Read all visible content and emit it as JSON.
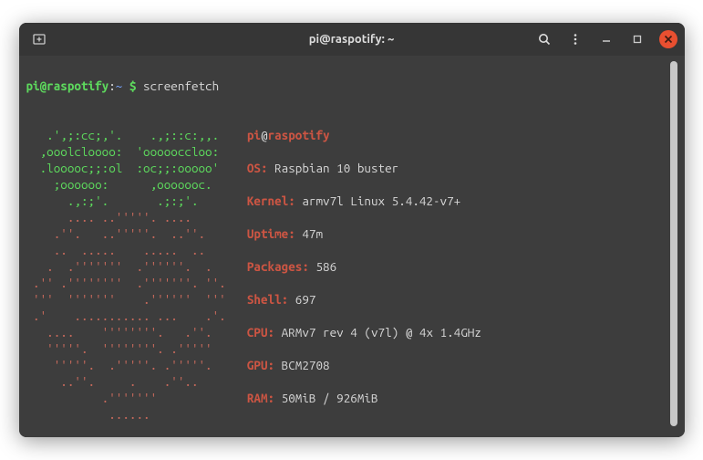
{
  "titlebar": {
    "title": "pi@raspotify: ~"
  },
  "prompt": {
    "user": "pi@raspotify",
    "sep": ":",
    "path": "~",
    "dollar": "$"
  },
  "command": "screenfetch",
  "ascii": {
    "l01": "   .',;:cc;,'.    .,;::c:,,.   ",
    "l02": "  ,ooolcloooo:  'oooooccloo:   ",
    "l03": "  .looooc;;:ol  :oc;;:ooooo'   ",
    "l04": "    ;oooooo:      ,ooooooc.    ",
    "l05": "      .,:;'.       .;:;'.      ",
    "l06": "      .... ..'''''. ....       ",
    "l07": "    .''.   ..'''''.  ..''.     ",
    "l08": "    ..  .....    .....  ..     ",
    "l09": "   .  .'''''''  .''''''.  .    ",
    "l10": " .'' .''''''''  .'''''''. ''.  ",
    "l11": " '''  '''''''    .''''''  '''  ",
    "l12": " .'    ........... ...    .'.  ",
    "l13": "   ....    ''''''''.   .''.    ",
    "l14": "   '''''.  ''''''''. .'''''    ",
    "l15": "    '''''.  .'''''. .'''''.    ",
    "l16": "     ..''.     .    .''..      ",
    "l17": "           .'''''''            ",
    "l18": "            ......             "
  },
  "info": {
    "user": "pi",
    "at": "@",
    "host": "raspotify",
    "os_label": "OS:",
    "os_value": " Raspbian 10 buster",
    "kernel_label": "Kernel:",
    "kernel_value": " armv7l Linux 5.4.42-v7+",
    "uptime_label": "Uptime:",
    "uptime_value": " 47m",
    "packages_label": "Packages:",
    "packages_value": " 586",
    "shell_label": "Shell:",
    "shell_value": " 697",
    "cpu_label": "CPU:",
    "cpu_value": " ARMv7 rev 4 (v7l) @ 4x 1.4GHz",
    "gpu_label": "GPU:",
    "gpu_value": " BCM2708",
    "ram_label": "RAM:",
    "ram_value": " 50MiB / 926MiB"
  }
}
